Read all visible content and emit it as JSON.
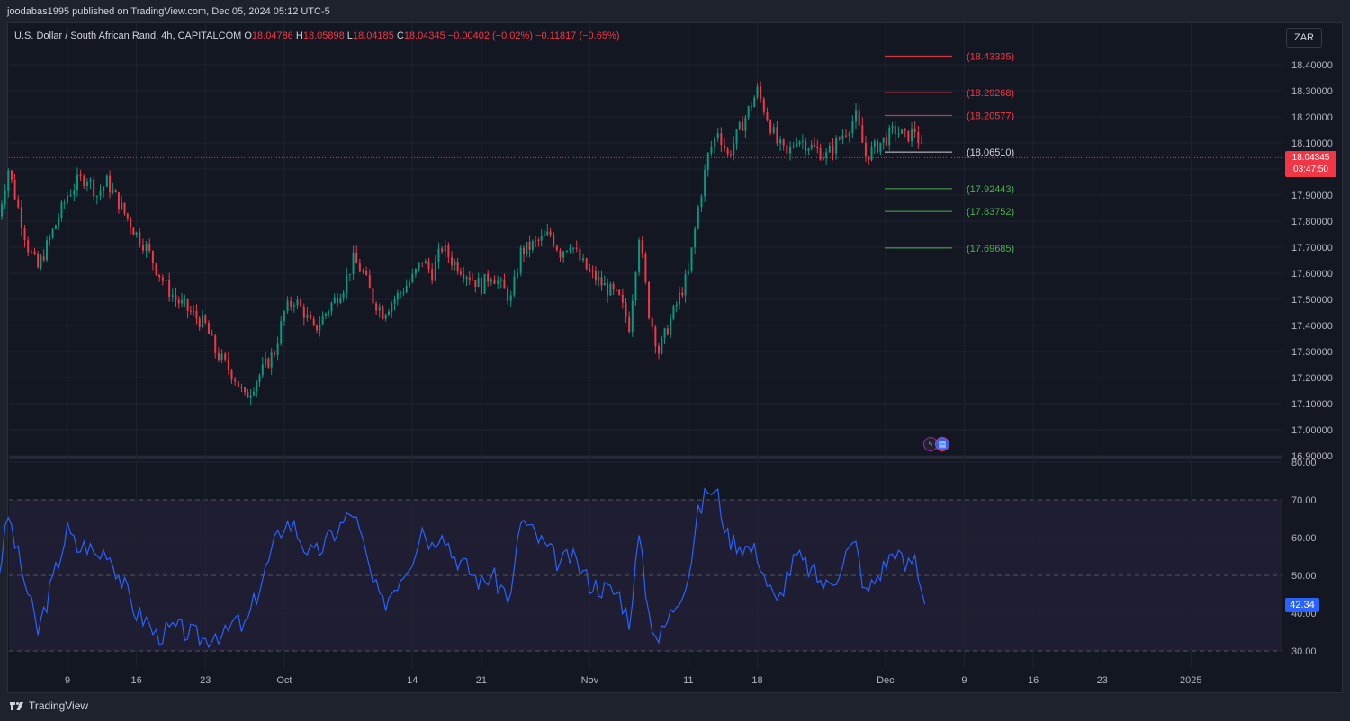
{
  "publisher": "joodabas1995 published on TradingView.com, Dec 05, 2024 05:12 UTC-5",
  "legend": {
    "symbol": "U.S. Dollar / South African Rand, 4h, CAPITALCOM",
    "o_label": "O",
    "o_value": "18.04786",
    "h_label": "H",
    "h_value": "18.05898",
    "l_label": "L",
    "l_value": "18.04185",
    "c_label": "C",
    "c_value": "18.04345",
    "change": "−0.00402 (−0.02%)",
    "change2": "−0.11817 (−0.65%)"
  },
  "currency": "ZAR",
  "last_price": {
    "price": "18.04345",
    "countdown": "03:47:50"
  },
  "rsi_value": "42.34",
  "brand": "TradingView",
  "colors": {
    "up": "#089981",
    "down": "#f23645",
    "rsi": "#2962ff",
    "background": "#131722"
  },
  "chart_data": [
    {
      "type": "candlestick",
      "symbol": "USD/ZAR",
      "timeframe": "4h",
      "ylim": [
        16.9,
        18.45
      ],
      "y_ticks": [
        "18.40000",
        "18.30000",
        "18.20000",
        "18.10000",
        "18.00000",
        "17.90000",
        "17.80000",
        "17.70000",
        "17.60000",
        "17.50000",
        "17.40000",
        "17.30000",
        "17.20000",
        "17.10000",
        "17.00000",
        "16.90000"
      ],
      "x_ticks": [
        "9",
        "16",
        "23",
        "Oct",
        "14",
        "21",
        "Nov",
        "11",
        "18",
        "Dec",
        "9",
        "16",
        "23",
        "2025"
      ],
      "approx_close_path": [
        [
          "Sep 2",
          17.82
        ],
        [
          "Sep 3",
          18.0
        ],
        [
          "Sep 4",
          17.85
        ],
        [
          "Sep 5",
          17.7
        ],
        [
          "Sep 6",
          17.62
        ],
        [
          "Sep 9",
          17.9
        ],
        [
          "Sep 10",
          17.95
        ],
        [
          "Sep 11",
          17.97
        ],
        [
          "Sep 12",
          17.9
        ],
        [
          "Sep 13",
          17.95
        ],
        [
          "Sep 16",
          17.75
        ],
        [
          "Sep 17",
          17.7
        ],
        [
          "Sep 18",
          17.62
        ],
        [
          "Sep 19",
          17.55
        ],
        [
          "Sep 20",
          17.5
        ],
        [
          "Sep 23",
          17.4
        ],
        [
          "Sep 24",
          17.3
        ],
        [
          "Sep 25",
          17.25
        ],
        [
          "Sep 26",
          17.2
        ],
        [
          "Sep 27",
          17.12
        ],
        [
          "Sep 30",
          17.3
        ],
        [
          "Oct 1",
          17.45
        ],
        [
          "Oct 2",
          17.5
        ],
        [
          "Oct 3",
          17.45
        ],
        [
          "Oct 4",
          17.38
        ],
        [
          "Oct 7",
          17.55
        ],
        [
          "Oct 8",
          17.65
        ],
        [
          "Oct 9",
          17.6
        ],
        [
          "Oct 10",
          17.5
        ],
        [
          "Oct 11",
          17.45
        ],
        [
          "Oct 14",
          17.58
        ],
        [
          "Oct 15",
          17.65
        ],
        [
          "Oct 16",
          17.6
        ],
        [
          "Oct 17",
          17.7
        ],
        [
          "Oct 18",
          17.65
        ],
        [
          "Oct 21",
          17.55
        ],
        [
          "Oct 22",
          17.6
        ],
        [
          "Oct 23",
          17.55
        ],
        [
          "Oct 24",
          17.5
        ],
        [
          "Oct 25",
          17.68
        ],
        [
          "Oct 28",
          17.75
        ],
        [
          "Oct 29",
          17.68
        ],
        [
          "Oct 30",
          17.72
        ],
        [
          "Oct 31",
          17.65
        ],
        [
          "Nov 1",
          17.6
        ],
        [
          "Nov 4",
          17.5
        ],
        [
          "Nov 5",
          17.4
        ],
        [
          "Nov 6",
          17.75
        ],
        [
          "Nov 7",
          17.45
        ],
        [
          "Nov 8",
          17.3
        ],
        [
          "Nov 11",
          17.6
        ],
        [
          "Nov 12",
          17.85
        ],
        [
          "Nov 13",
          18.05
        ],
        [
          "Nov 14",
          18.15
        ],
        [
          "Nov 15",
          18.05
        ],
        [
          "Nov 18",
          18.3
        ],
        [
          "Nov 19",
          18.2
        ],
        [
          "Nov 20",
          18.1
        ],
        [
          "Nov 21",
          18.05
        ],
        [
          "Nov 22",
          18.12
        ],
        [
          "Nov 25",
          18.05
        ],
        [
          "Nov 26",
          18.1
        ],
        [
          "Nov 27",
          18.15
        ],
        [
          "Nov 28",
          18.2
        ],
        [
          "Nov 29",
          18.05
        ],
        [
          "Dec 2",
          18.15
        ],
        [
          "Dec 3",
          18.12
        ],
        [
          "Dec 4",
          18.15
        ],
        [
          "Dec 5",
          18.04
        ]
      ],
      "levels": [
        {
          "label": "(18.43335)",
          "value": 18.43335,
          "color": "#f23645"
        },
        {
          "label": "(18.29268)",
          "value": 18.29268,
          "color": "#f23645"
        },
        {
          "label": "(18.20577)",
          "value": 18.20577,
          "color": "#f23645"
        },
        {
          "label": "(18.06510)",
          "value": 18.0651,
          "color": "#d1d4dc"
        },
        {
          "label": "(17.92443)",
          "value": 17.92443,
          "color": "#4caf50"
        },
        {
          "label": "(17.83752)",
          "value": 17.83752,
          "color": "#4caf50"
        },
        {
          "label": "(17.69685)",
          "value": 17.69685,
          "color": "#4caf50"
        }
      ],
      "last": 18.04345
    },
    {
      "type": "line",
      "name": "RSI",
      "ylim": [
        30,
        80
      ],
      "y_ticks": [
        "80.00",
        "70.00",
        "60.00",
        "50.00",
        "40.00",
        "30.00"
      ],
      "band": [
        30,
        70
      ],
      "approx_values": [
        [
          "Sep 2",
          50
        ],
        [
          "Sep 3",
          66
        ],
        [
          "Sep 4",
          55
        ],
        [
          "Sep 5",
          45
        ],
        [
          "Sep 6",
          35
        ],
        [
          "Sep 9",
          62
        ],
        [
          "Sep 10",
          57
        ],
        [
          "Sep 11",
          58
        ],
        [
          "Sep 12",
          55
        ],
        [
          "Sep 13",
          57
        ],
        [
          "Sep 16",
          40
        ],
        [
          "Sep 17",
          38
        ],
        [
          "Sep 18",
          34
        ],
        [
          "Sep 19",
          35
        ],
        [
          "Sep 20",
          36
        ],
        [
          "Sep 23",
          33
        ],
        [
          "Sep 24",
          35
        ],
        [
          "Sep 25",
          34
        ],
        [
          "Sep 26",
          38
        ],
        [
          "Sep 27",
          36
        ],
        [
          "Sep 30",
          58
        ],
        [
          "Oct 1",
          64
        ],
        [
          "Oct 2",
          63
        ],
        [
          "Oct 3",
          58
        ],
        [
          "Oct 4",
          55
        ],
        [
          "Oct 7",
          64
        ],
        [
          "Oct 8",
          67
        ],
        [
          "Oct 9",
          58
        ],
        [
          "Oct 10",
          48
        ],
        [
          "Oct 11",
          42
        ],
        [
          "Oct 14",
          55
        ],
        [
          "Oct 15",
          63
        ],
        [
          "Oct 16",
          58
        ],
        [
          "Oct 17",
          63
        ],
        [
          "Oct 18",
          56
        ],
        [
          "Oct 21",
          48
        ],
        [
          "Oct 22",
          50
        ],
        [
          "Oct 23",
          47
        ],
        [
          "Oct 24",
          44
        ],
        [
          "Oct 25",
          65
        ],
        [
          "Oct 28",
          56
        ],
        [
          "Oct 29",
          53
        ],
        [
          "Oct 30",
          55
        ],
        [
          "Oct 31",
          52
        ],
        [
          "Nov 1",
          48
        ],
        [
          "Nov 4",
          45
        ],
        [
          "Nov 5",
          38
        ],
        [
          "Nov 6",
          60
        ],
        [
          "Nov 7",
          40
        ],
        [
          "Nov 8",
          33
        ],
        [
          "Nov 11",
          50
        ],
        [
          "Nov 12",
          66
        ],
        [
          "Nov 13",
          73
        ],
        [
          "Nov 14",
          71
        ],
        [
          "Nov 15",
          60
        ],
        [
          "Nov 18",
          56
        ],
        [
          "Nov 19",
          48
        ],
        [
          "Nov 20",
          42
        ],
        [
          "Nov 21",
          50
        ],
        [
          "Nov 22",
          55
        ],
        [
          "Nov 25",
          47
        ],
        [
          "Nov 26",
          50
        ],
        [
          "Nov 27",
          56
        ],
        [
          "Nov 28",
          58
        ],
        [
          "Nov 29",
          45
        ],
        [
          "Dec 2",
          57
        ],
        [
          "Dec 3",
          52
        ],
        [
          "Dec 4",
          55
        ],
        [
          "Dec 5",
          42.34
        ]
      ],
      "last": 42.34
    }
  ]
}
